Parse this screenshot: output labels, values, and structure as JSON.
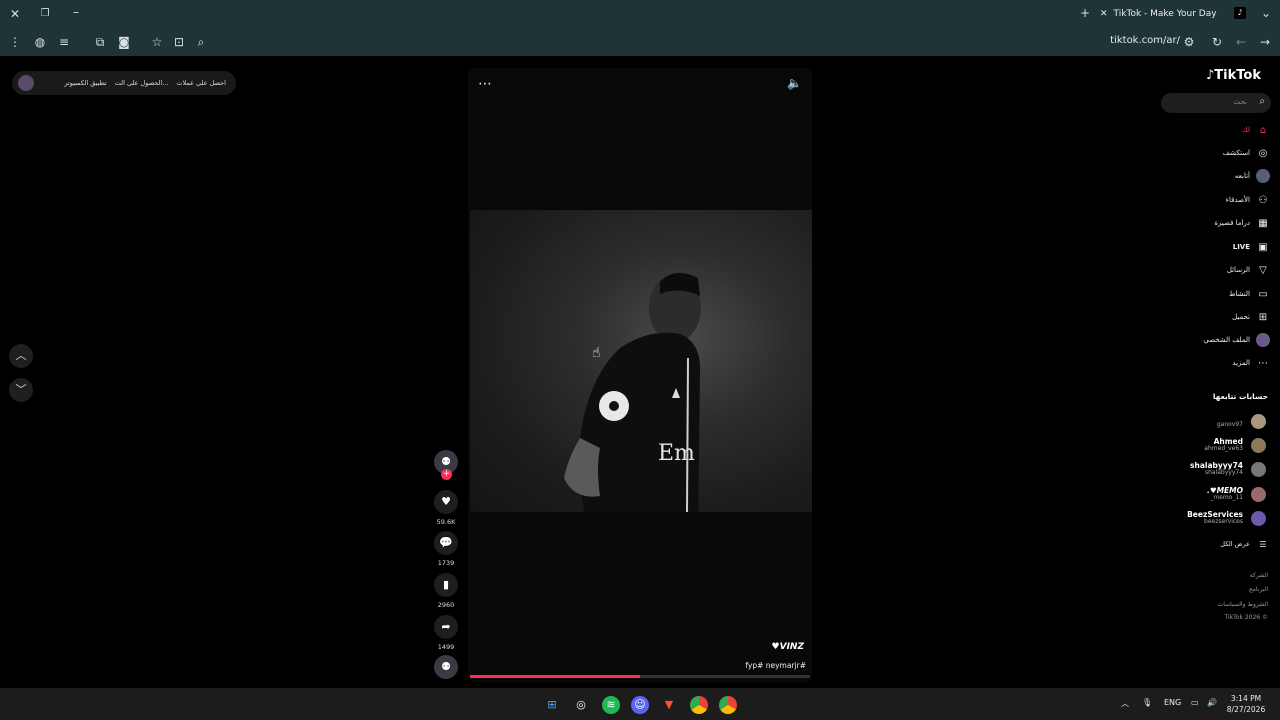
{
  "browser": {
    "tab_title": "TikTok - Make Your Day",
    "url": "tiktok.com/ar/",
    "tab_icon": "tiktok-icon"
  },
  "app_pill": {
    "items": [
      "احصل على عملات",
      "الحصول على الت...",
      "تطبيق الكمبيوتر"
    ]
  },
  "video": {
    "author": "♥VINZ",
    "caption": "fyp# neymarjr#",
    "progress": 0.5
  },
  "actions": {
    "likes": "59.6K",
    "comments": "1739",
    "saves": "2960",
    "shares": "1499"
  },
  "sidebar": {
    "logo": "TikTok",
    "search_placeholder": "بحث",
    "nav": [
      {
        "label": "لك",
        "icon": "home-icon"
      },
      {
        "label": "استكشف",
        "icon": "compass-icon"
      },
      {
        "label": "أتابعه",
        "icon": "avatar-icon"
      },
      {
        "label": "الأصدقاء",
        "icon": "friends-icon"
      },
      {
        "label": "دراما قصيرة",
        "icon": "drama-icon"
      },
      {
        "label": "LIVE",
        "icon": "live-icon"
      },
      {
        "label": "الرسائل",
        "icon": "send-icon"
      },
      {
        "label": "النشاط",
        "icon": "inbox-icon"
      },
      {
        "label": "تحميل",
        "icon": "upload-icon"
      },
      {
        "label": "الملف الشخصي",
        "icon": "profile-icon"
      },
      {
        "label": "المزيد",
        "icon": "more-icon"
      }
    ],
    "following_title": "حسابات تتابعها",
    "following": [
      {
        "name": "",
        "handle": "ganov97"
      },
      {
        "name": "Ahmed",
        "handle": "ahmed_ve63"
      },
      {
        "name": "shalabyyy74",
        "handle": "shalabyyy74"
      },
      {
        "name": ".♥MEMO",
        "handle": "_memo_11"
      },
      {
        "name": "BeezServices",
        "handle": "beezservices"
      }
    ],
    "show_all": "عرض الكل",
    "footer": [
      "الشركة",
      "البرنامج",
      "الشروط والسياسات",
      "TikTok 2026 ©"
    ]
  },
  "taskbar": {
    "lang": "ENG",
    "time": "3:14 PM",
    "date": "8/27/2026"
  },
  "colors": {
    "accent": "#fe2c55",
    "chrome": "#1f3437",
    "taskbar": "#1c1c1c"
  }
}
